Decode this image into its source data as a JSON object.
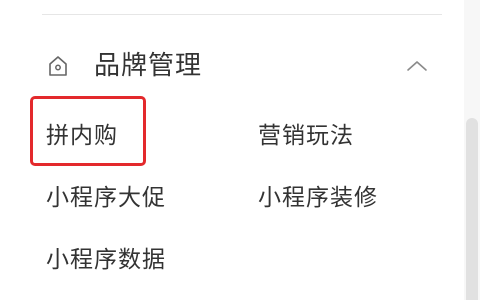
{
  "section": {
    "title": "品牌管理",
    "icon": "house-icon",
    "expanded": true
  },
  "menu": {
    "items": [
      {
        "label": "拼内购"
      },
      {
        "label": "营销玩法"
      },
      {
        "label": "小程序大促"
      },
      {
        "label": "小程序装修"
      },
      {
        "label": "小程序数据"
      }
    ]
  },
  "highlight": {
    "color": "#e3292c",
    "target": "拼内购"
  }
}
